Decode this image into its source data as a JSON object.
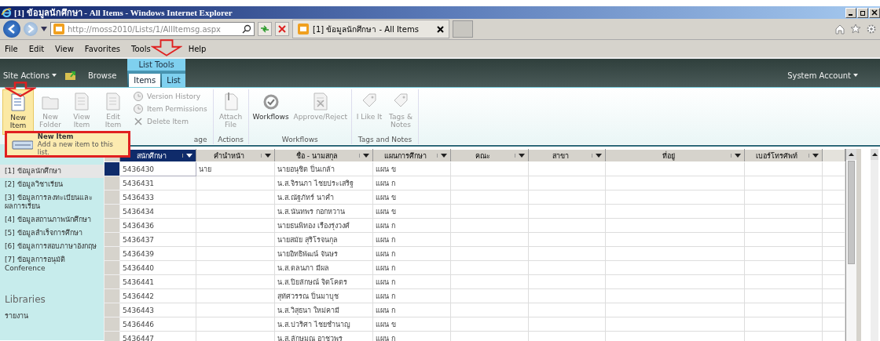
{
  "window": {
    "title": "[1] ข้อมูลนักศึกษา - All Items - Windows Internet Explorer"
  },
  "browser": {
    "address": "http://moss2010/Lists/1/AllItemsg.aspx",
    "tab_title": "[1] ข้อมูลนักศึกษา - All Items"
  },
  "menu": [
    "File",
    "Edit",
    "View",
    "Favorites",
    "Tools",
    "Help"
  ],
  "ribbon": {
    "site_actions": "Site Actions",
    "browse": "Browse",
    "context_label": "List Tools",
    "tabs": [
      {
        "label": "Items",
        "selected": true
      },
      {
        "label": "List",
        "selected": false
      }
    ],
    "account": "System Account",
    "groups": [
      {
        "label": "age",
        "items": [
          {
            "kind": "large",
            "label": "New Item",
            "disabled": false,
            "active": true
          },
          {
            "kind": "large",
            "label": "New Folder",
            "disabled": true,
            "active": false
          },
          {
            "kind": "large",
            "label": "View Item",
            "disabled": true,
            "active": false
          },
          {
            "kind": "large",
            "label": "Edit Item",
            "disabled": true,
            "active": false
          },
          {
            "kind": "small",
            "label": "Version History",
            "disabled": true,
            "active": false
          },
          {
            "kind": "small",
            "label": "Item Permissions",
            "disabled": true,
            "active": false
          },
          {
            "kind": "small",
            "label": "Delete Item",
            "disabled": true,
            "active": false
          }
        ]
      },
      {
        "label": "Actions",
        "items": [
          {
            "kind": "large",
            "label": "Attach File",
            "disabled": true,
            "active": false
          }
        ]
      },
      {
        "label": "Workflows",
        "items": [
          {
            "kind": "large",
            "label": "Workflows",
            "disabled": false,
            "active": false
          },
          {
            "kind": "large",
            "label": "Approve/Reject",
            "disabled": true,
            "active": false
          }
        ]
      },
      {
        "label": "Tags and Notes",
        "items": [
          {
            "kind": "large",
            "label": "I Like It",
            "disabled": true,
            "active": false
          },
          {
            "kind": "large",
            "label": "Tags & Notes",
            "disabled": true,
            "active": false
          }
        ]
      }
    ]
  },
  "popup": {
    "title": "New Item",
    "description": "Add a new item to this list."
  },
  "sidebar": {
    "items": [
      {
        "label": "[1] ข้อมูลนักศึกษา",
        "selected": true
      },
      {
        "label": "[2] ข้อมูลวิชาเรียน",
        "selected": false
      },
      {
        "label": "[3] ข้อมูลการลงทะเบียนและผลการเรียน",
        "selected": false
      },
      {
        "label": "[4] ข้อมูลสถานภาพนักศึกษา",
        "selected": false
      },
      {
        "label": "[5] ข้อมูลสำเร็จการศึกษา",
        "selected": false
      },
      {
        "label": "[6] ข้อมูลการสอบภาษาอังกฤษ",
        "selected": false
      },
      {
        "label": "[7] ข้อมูลการอนุมัติ Conference",
        "selected": false
      }
    ],
    "libraries_heading": "Libraries",
    "library_items": [
      "รายงาน"
    ]
  },
  "table": {
    "columns": [
      "สนักศึกษา",
      "คำนำหน้า",
      "ชื่อ - นามสกุล",
      "แผนการศึกษา",
      "คณะ",
      "สาขา",
      "ที่อยู่",
      "เบอร์โทรศัพท์"
    ],
    "rows": [
      {
        "id": "5436430",
        "prefix": "นาย",
        "name": "นายอนุชิต ปิ่นเกล้า",
        "plan": "แผน ข",
        "selected": true
      },
      {
        "id": "5436431",
        "name": "น.ส.จิรนภา ไชยประเสริฐ",
        "plan": "แผน ก",
        "selected": false
      },
      {
        "id": "5436433",
        "name": "น.ส.ณัฐภัทร์ นาคำ",
        "plan": "แผน ข",
        "selected": false
      },
      {
        "id": "5436434",
        "name": "น.ส.นันทพร กอกหวาน",
        "plan": "แผน ข",
        "selected": false
      },
      {
        "id": "5436436",
        "name": "นายธนพิทอง เรืองรุ่งวงศ์",
        "plan": "แผน ก",
        "selected": false
      },
      {
        "id": "5436437",
        "name": "นายสมัย สุริโรจนกุล",
        "plan": "แผน ก",
        "selected": false
      },
      {
        "id": "5436439",
        "name": "นายอิทธิพัฒน์ จันษร",
        "plan": "แผน ก",
        "selected": false
      },
      {
        "id": "5436440",
        "name": "น.ส.ดลนภา มีผล",
        "plan": "แผน ก",
        "selected": false
      },
      {
        "id": "5436441",
        "name": "น.ส.ปิยลักษณ์ จิตโคตร",
        "plan": "แผน ก",
        "selected": false
      },
      {
        "id": "5436442",
        "name": "สุทัศวรรณ ปิ่นมาบุช",
        "plan": "แผน ก",
        "selected": false
      },
      {
        "id": "5436443",
        "name": "น.ส.วิสุธนา ใหม่คามี",
        "plan": "แผน ก",
        "selected": false
      },
      {
        "id": "5436446",
        "name": "น.ส.ปวริศา ไชยชำนาญ",
        "plan": "แผน ข",
        "selected": false
      },
      {
        "id": "5436447",
        "name": "น.ส.ลักษมณ อาชวพร",
        "plan": "แผน ก",
        "selected": false
      }
    ]
  }
}
